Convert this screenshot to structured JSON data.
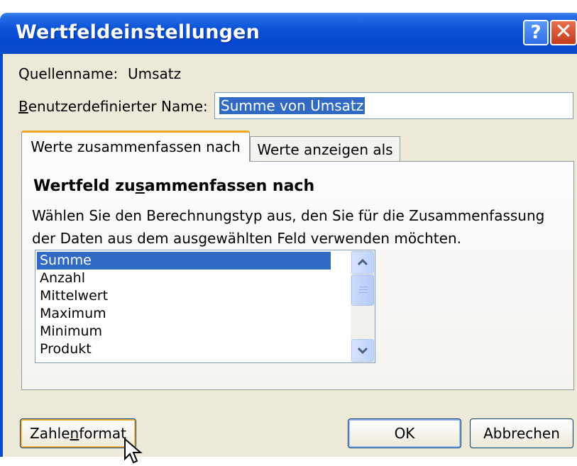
{
  "window": {
    "title": "Wertfeldeinstellungen",
    "help_glyph": "?",
    "close_glyph": "✕"
  },
  "source": {
    "label": "Quellenname:",
    "value": "Umsatz"
  },
  "custom_name": {
    "label_underlined": "B",
    "label_rest": "enutzerdefinierter Name:",
    "value": "Summe von Umsatz"
  },
  "tabs": [
    {
      "label": "Werte zusammenfassen nach",
      "active": true
    },
    {
      "label": "Werte anzeigen als",
      "active": false
    }
  ],
  "panel": {
    "title_pre": "Wertfeld zu",
    "title_underlined": "s",
    "title_post": "ammenfassen nach",
    "desc_line1": "Wählen Sie den Berechnungstyp aus, den Sie für die Zusammenfassung",
    "desc_line2": "der Daten aus dem ausgewählten Feld verwenden möchten."
  },
  "functions": {
    "selected": "Summe",
    "items": [
      "Summe",
      "Anzahl",
      "Mittelwert",
      "Maximum",
      "Minimum",
      "Produkt"
    ]
  },
  "buttons": {
    "number_format_pre": "Zahle",
    "number_format_underlined": "n",
    "number_format_post": "format",
    "ok": "OK",
    "cancel": "Abbrechen"
  },
  "icons": {
    "help": "help-icon",
    "close": "close-icon",
    "scroll_up": "chevron-up-icon",
    "scroll_down": "chevron-down-icon",
    "cursor": "mouse-pointer-icon"
  },
  "colors": {
    "titlebar": "#0a52d8",
    "selection": "#316ac5",
    "dialog_bg": "#ece9d8",
    "active_tab_accent": "#f5a623"
  }
}
